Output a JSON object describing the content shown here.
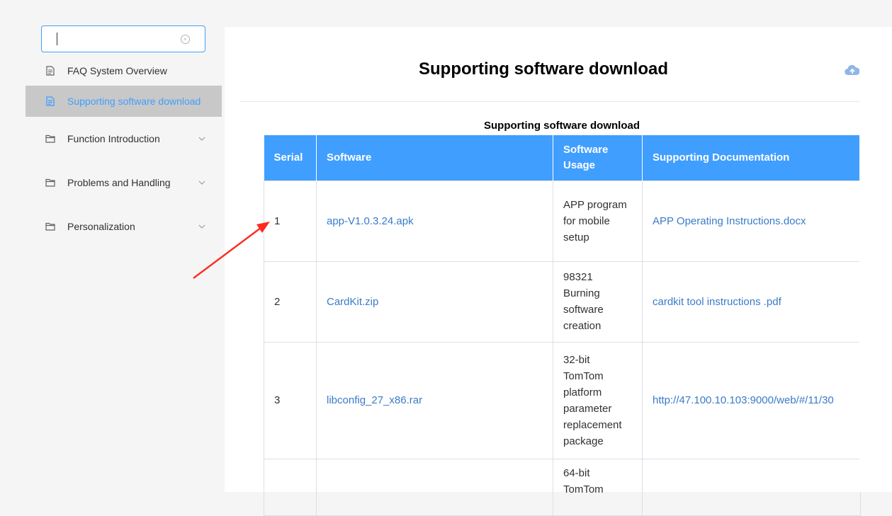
{
  "sidebar": {
    "search": {
      "value": "",
      "placeholder": ""
    },
    "items": [
      {
        "label": "FAQ System Overview",
        "icon": "document-icon"
      },
      {
        "label": "Supporting software download",
        "icon": "document-icon",
        "active": true
      },
      {
        "label": "Function Introduction",
        "icon": "folder-icon"
      },
      {
        "label": "Problems and Handling",
        "icon": "folder-icon"
      },
      {
        "label": "Personalization",
        "icon": "folder-icon"
      }
    ]
  },
  "main": {
    "title": "Supporting software download",
    "upload_icon": "cloud-upload-icon",
    "table": {
      "caption": "Supporting software download",
      "headers": [
        "Serial",
        "Software",
        "Software Usage",
        "Supporting Documentation"
      ],
      "rows": [
        {
          "serial": "1",
          "software": "app-V1.0.3.24.apk",
          "usage": "APP program for mobile setup",
          "doc": "APP Operating Instructions.docx"
        },
        {
          "serial": "2",
          "software": "CardKit.zip",
          "usage": "98321 Burning software creation",
          "doc": "cardkit tool instructions .pdf"
        },
        {
          "serial": "3",
          "software": "libconfig_27_x86.rar",
          "usage": "32-bit TomTom platform parameter replacement package",
          "doc": "http://47.100.10.103:9000/web/#/11/30"
        },
        {
          "serial": "",
          "software": "",
          "usage": "64-bit TomTom",
          "doc": ""
        }
      ]
    }
  },
  "colors": {
    "accent": "#409eff",
    "link": "#3a7bc8",
    "active_bg": "#c8c8c8",
    "annotation": "#ff2a1f"
  }
}
